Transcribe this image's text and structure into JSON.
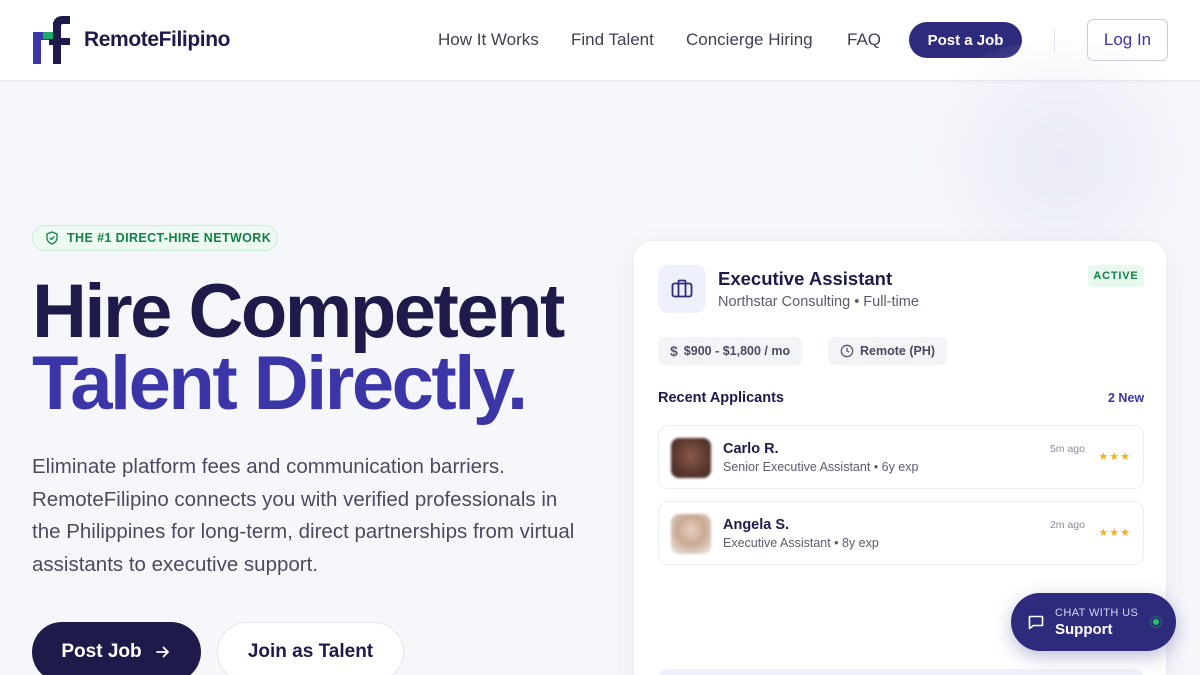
{
  "header": {
    "brand": "RemoteFilipino",
    "nav": [
      "How It Works",
      "Find Talent",
      "Concierge Hiring",
      "FAQ"
    ],
    "post_job": "Post a Job",
    "login": "Log In"
  },
  "hero": {
    "badge": "THE #1 DIRECT-HIRE NETWORK",
    "headline_line1": "Hire Competent",
    "headline_line2": "Talent Directly.",
    "subtext": "Eliminate platform fees and communication barriers. RemoteFilipino connects you with verified professionals in the Philippines for long-term, direct partnerships from virtual assistants to executive support.",
    "cta_primary": "Post Job",
    "cta_secondary": "Join as Talent"
  },
  "job_card": {
    "title": "Executive Assistant",
    "company_meta": "Northstar Consulting • Full-time",
    "status": "ACTIVE",
    "salary": "$900 - $1,800 / mo",
    "location": "Remote (PH)",
    "section_title": "Recent Applicants",
    "new_count": "2 New",
    "applicants": [
      {
        "name": "Carlo R.",
        "role": "Senior Executive Assistant • 6y exp",
        "time": "5m ago",
        "stars": "★★★"
      },
      {
        "name": "Angela S.",
        "role": "Executive Assistant • 8y exp",
        "time": "2m ago",
        "stars": "★★★"
      }
    ]
  },
  "chat": {
    "label": "CHAT WITH US",
    "title": "Support"
  },
  "colors": {
    "brand_navy": "#1e1b4b",
    "brand_indigo": "#3b35a8",
    "button_indigo": "#2e2a7c",
    "success_green": "#14804a",
    "star_gold": "#f3b21c"
  },
  "icons": {
    "logo": "rf-logo-icon",
    "badge": "shield-check-icon",
    "job": "briefcase-icon",
    "salary": "dollar-icon",
    "location": "clock-icon",
    "cta": "arrow-right-icon",
    "chat": "chat-bubble-icon"
  }
}
